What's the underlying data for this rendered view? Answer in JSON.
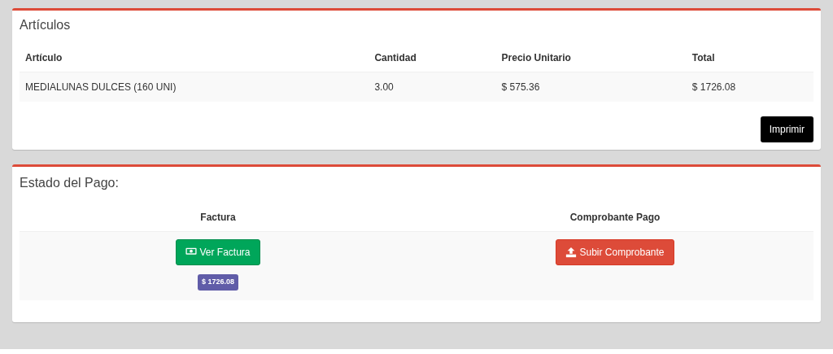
{
  "articles": {
    "title": "Artículos",
    "columns": [
      "Artículo",
      "Cantidad",
      "Precio Unitario",
      "Total"
    ],
    "rows": [
      [
        "MEDIALUNAS DULCES (160 UNI)",
        "3.00",
        "$ 575.36",
        "$ 1726.08"
      ]
    ],
    "print_button": "Imprimir"
  },
  "payment": {
    "title": "Estado del Pago:",
    "columns": [
      {
        "heading": "Factura",
        "button": {
          "label": "Ver Factura",
          "kind": "invoice"
        },
        "amount": "$ 1726.08"
      },
      {
        "heading": "Comprobante Pago",
        "button": {
          "label": "Subir Comprobante",
          "kind": "upload"
        }
      }
    ]
  }
}
